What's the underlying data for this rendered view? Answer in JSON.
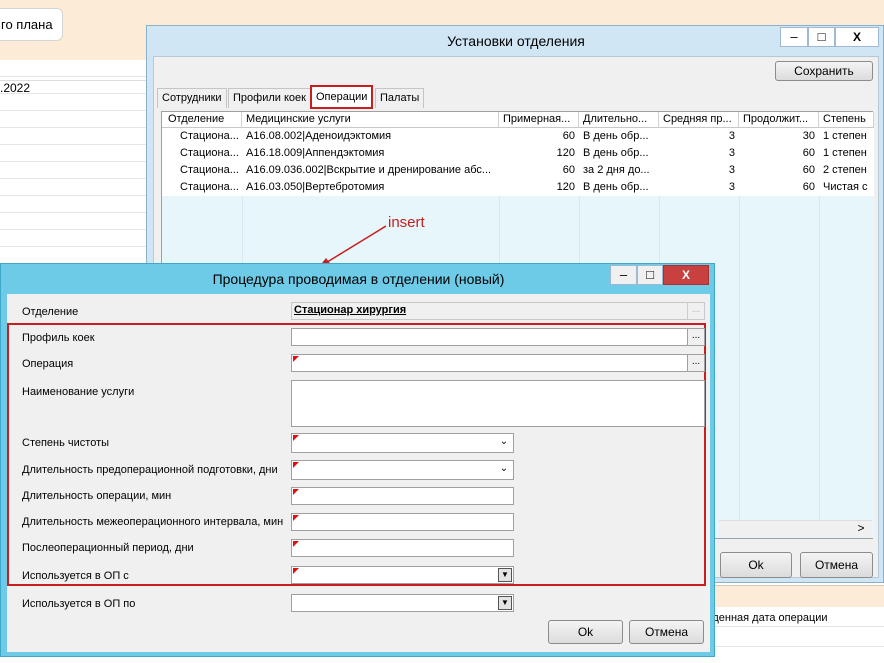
{
  "background": {
    "chip_label": "го плана",
    "date_text": ".2022",
    "bottom_right_text": "жденная дата операции"
  },
  "settings_window": {
    "title": "Установки отделения",
    "controls": {
      "minimize": "–",
      "maximize": "□",
      "close": "X"
    },
    "save_button": "Сохранить",
    "tabs": [
      "Сотрудники",
      "Профили коек",
      "Операции",
      "Палаты"
    ],
    "active_tab": "Операции",
    "columns": [
      "Отделение",
      "Медицинские услуги",
      "Примерная...",
      "Длительно...",
      "Средняя пр...",
      "Продолжит...",
      "Степень"
    ],
    "rows": [
      [
        "Стациона...",
        "A16.08.002|Аденоидэктомия",
        "60",
        "В день обр...",
        "3",
        "30",
        "1 степен"
      ],
      [
        "Стациона...",
        "A16.18.009|Аппендэктомия",
        "120",
        "В день обр...",
        "3",
        "60",
        "1 степен"
      ],
      [
        "Стациона...",
        "A16.09.036.002|Вскрытие и дренирование абс...",
        "60",
        "за 2 дня до...",
        "3",
        "60",
        "2 степен"
      ],
      [
        "Стациона...",
        "A16.03.050|Вертебротомия",
        "120",
        "В день обр...",
        "3",
        "60",
        "Чистая с"
      ]
    ],
    "scroll_right": ">",
    "ok_button": "Ok",
    "cancel_button": "Отмена"
  },
  "annotation": {
    "label": "insert",
    "color": "#c81e1e"
  },
  "procedure_dialog": {
    "title": "Процедура проводимая в отделении (новый)",
    "controls": {
      "minimize": "–",
      "maximize": "□",
      "close": "X"
    },
    "fields": {
      "department": {
        "label": "Отделение",
        "value": "Стационар  хирургия"
      },
      "bed_profile": {
        "label": "Профиль коек",
        "value": ""
      },
      "operation": {
        "label": "Операция",
        "value": ""
      },
      "service_name": {
        "label": "Наименование услуги",
        "value": ""
      },
      "cleanliness": {
        "label": "Степень чистоты",
        "value": ""
      },
      "preop_duration": {
        "label": "Длительность предоперационной подготовки, дни",
        "value": ""
      },
      "op_duration": {
        "label": "Длительность операции, мин",
        "value": ""
      },
      "interval": {
        "label": "Длительность межеоперационного интервала, мин",
        "value": ""
      },
      "postop": {
        "label": "Послеоперационный период, дни",
        "value": ""
      },
      "used_from": {
        "label": "Используется в ОП с",
        "value": ""
      },
      "used_to": {
        "label": "Используется в ОП по",
        "value": ""
      }
    },
    "ellipsis": "...",
    "ok_button": "Ok",
    "cancel_button": "Отмена"
  }
}
